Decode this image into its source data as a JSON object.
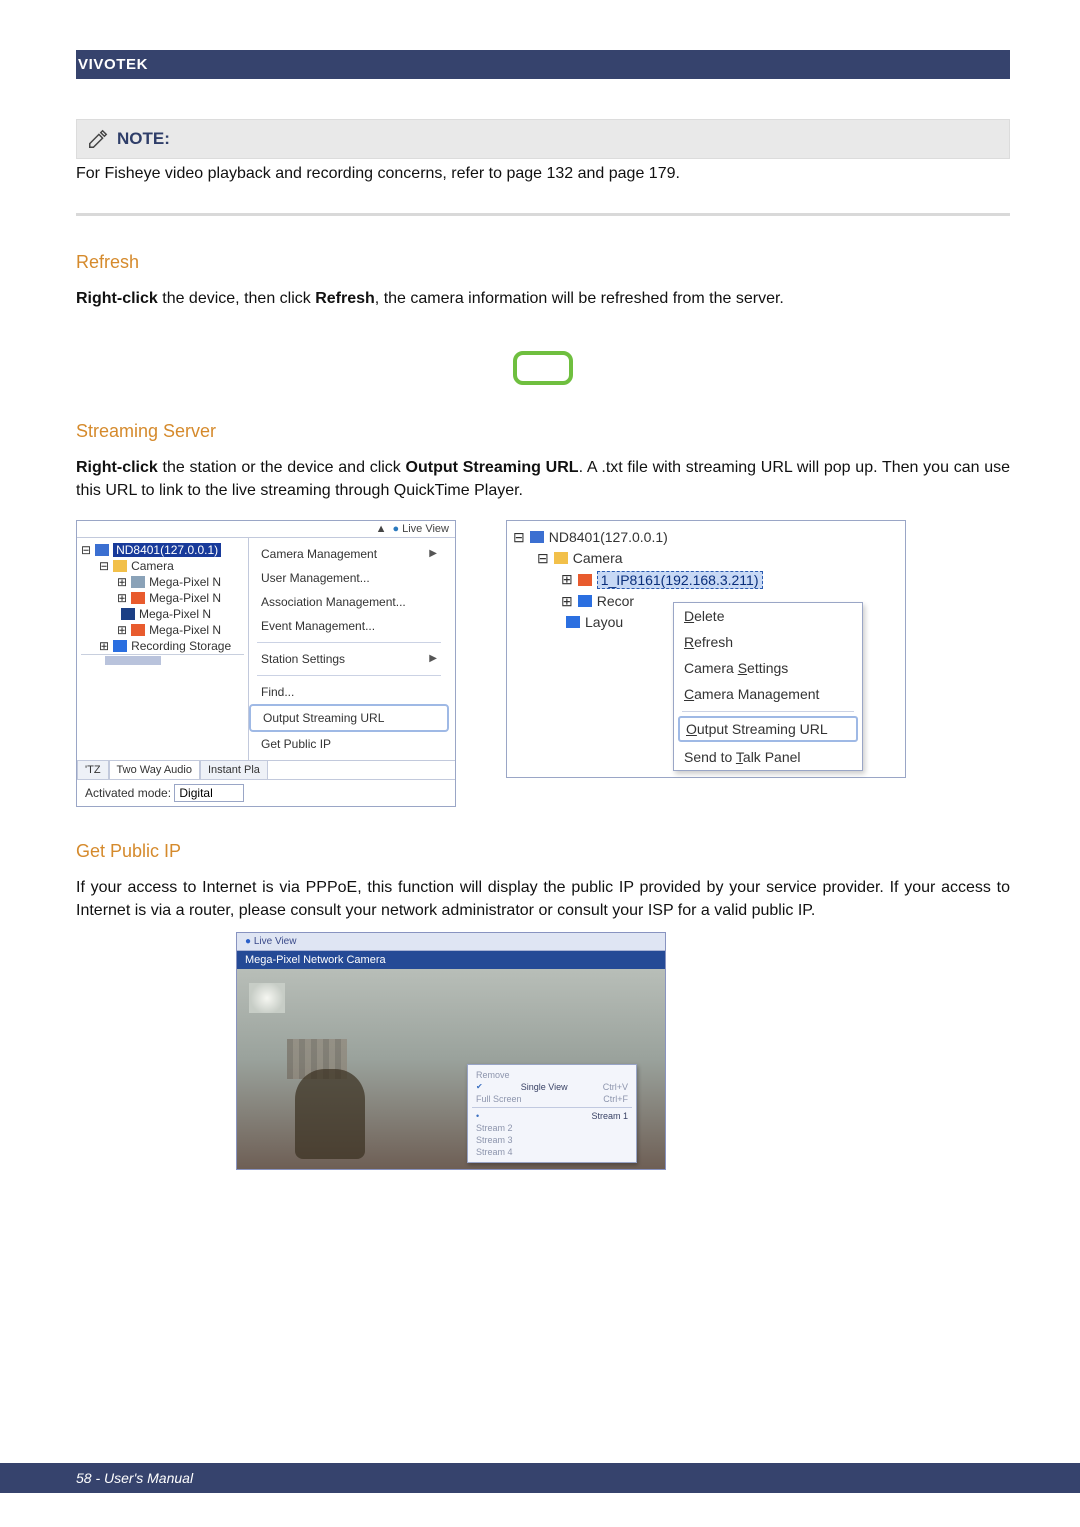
{
  "header": {
    "brand": "VIVOTEK"
  },
  "note": {
    "title": "NOTE:",
    "text": "For Fisheye video playback and recording concerns, refer to page 132 and page 179."
  },
  "refresh": {
    "title": "Refresh",
    "p_prefix": "Right-click",
    "p_mid": " the device, then click ",
    "p_bold2": "Refresh",
    "p_suffix": ", the camera information will be refreshed from the server."
  },
  "streaming": {
    "title": "Streaming Server",
    "p_prefix": "Right-click",
    "p_mid": " the station or the device and click ",
    "p_bold2": "Output Streaming URL",
    "p_suffix": ". A .txt file with streaming URL will pop up. Then you can use this URL to link to the live streaming through QuickTime Player."
  },
  "publicip": {
    "title": "Get Public IP",
    "p": "If your access to Internet is via PPPoE, this function will display the public IP provided by your service provider. If your access to Internet is via a router, please consult your network administrator or consult your ISP for a valid public IP."
  },
  "left_shot": {
    "top_arrow": "▲",
    "top_live": "Live View",
    "tree": {
      "root": "ND8401(127.0.0.1)",
      "camera_folder": "Camera",
      "children": [
        "Mega-Pixel N",
        "Mega-Pixel N",
        "Mega-Pixel N",
        "Mega-Pixel N"
      ],
      "storage": "Recording Storage"
    },
    "menu": [
      "Camera Management",
      "User Management...",
      "Association Management...",
      "Event Management...",
      "Station Settings",
      "Find...",
      "Output Streaming URL",
      "Get Public IP"
    ],
    "tabs": [
      "'TZ",
      "Two Way Audio",
      "Instant Pla"
    ],
    "mode_label": "Activated mode:",
    "mode_value": "Digital"
  },
  "right_shot": {
    "tree": {
      "root": "ND8401(127.0.0.1)",
      "camera_folder": "Camera",
      "selected": "1_IP8161(192.168.3.211)",
      "recor": "Recor",
      "layou": "Layou"
    },
    "menu": {
      "delete": "Delete",
      "refresh": "Refresh",
      "settings": "Camera Settings",
      "mgmt": "Camera Management",
      "output": "Output Streaming URL",
      "send": "Send to Talk Panel"
    }
  },
  "live_shot": {
    "tab": "Live View",
    "title": "Mega-Pixel Network Camera",
    "ctx": {
      "remove": "Remove",
      "single": "Single View",
      "single_k": "Ctrl+V",
      "full": "Full Screen",
      "full_k": "Ctrl+F",
      "s1": "Stream 1",
      "s2": "Stream 2",
      "s3": "Stream 3",
      "s4": "Stream 4"
    }
  },
  "footer": {
    "text": "58 - User's Manual"
  }
}
